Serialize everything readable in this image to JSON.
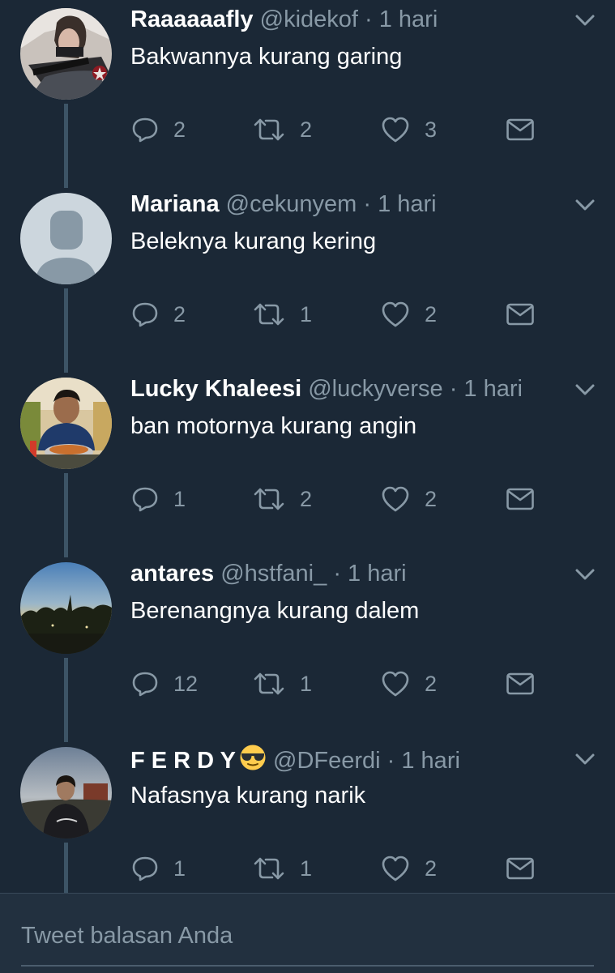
{
  "tweets": [
    {
      "name": "Raaaaaafly",
      "handle": "@kidekof",
      "time": "· 1 hari",
      "text": "Bakwannya kurang garing",
      "replies": "2",
      "retweets": "2",
      "likes": "3",
      "avatar": "avatar-soldier"
    },
    {
      "name": "Mariana",
      "handle": "@cekunyem",
      "time": "· 1 hari",
      "text": "Beleknya kurang kering",
      "replies": "2",
      "retweets": "1",
      "likes": "2",
      "avatar": "default-avatar"
    },
    {
      "name": "Lucky Khaleesi",
      "handle": "@luckyverse",
      "time": "· 1 hari",
      "text": "ban motornya kurang angin",
      "replies": "1",
      "retweets": "2",
      "likes": "2",
      "avatar": "avatar-photo-person"
    },
    {
      "name": "antares",
      "handle": "@hstfani_",
      "time": "· 1 hari",
      "text": "Berenangnya kurang dalem",
      "replies": "12",
      "retweets": "1",
      "likes": "2",
      "avatar": "avatar-sunset"
    },
    {
      "name": "F E R D Y",
      "handle": "@DFeerdi",
      "time": "· 1 hari",
      "text": "Nafasnya kurang narik",
      "replies": "1",
      "retweets": "1",
      "likes": "2",
      "avatar": "avatar-person-outdoor",
      "emoji": "sunglasses-emoji"
    }
  ],
  "composer": {
    "placeholder": "Tweet balasan Anda"
  },
  "colors": {
    "background": "#1b2836",
    "secondary_text": "#8899a6",
    "thread_line": "#3d5466"
  }
}
